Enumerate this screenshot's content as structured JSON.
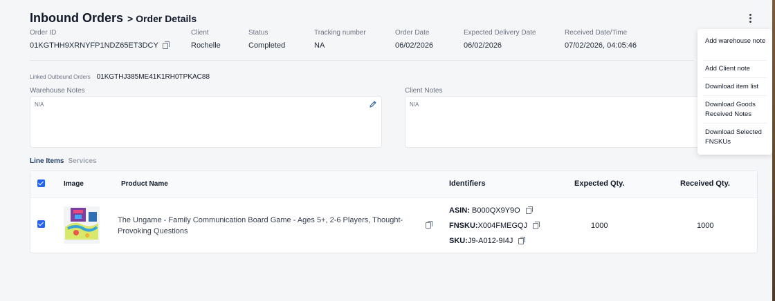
{
  "header": {
    "title": "Inbound Orders",
    "separator": ">",
    "breadcrumb": "Order Details"
  },
  "order": {
    "order_id_label": "Order ID",
    "order_id": "01KGTHH9XRNYFP1NDZ65ET3DCY",
    "client_label": "Client",
    "client": "Rochelle",
    "status_label": "Status",
    "status": "Completed",
    "tracking_label": "Tracking number",
    "tracking": "NA",
    "order_date_label": "Order Date",
    "order_date": "06/02/2026",
    "expected_label": "Expected Delivery Date",
    "expected": "06/02/2026",
    "received_label": "Received Date/Time",
    "received": "07/02/2026, 04:05:46"
  },
  "linked": {
    "label": "Linked Outbound Orders",
    "value": "01KGTHJ385ME41K1RH0TPKAC88"
  },
  "notes": {
    "warehouse_label": "Warehouse Notes",
    "warehouse_value": "N/A",
    "client_label": "Client Notes",
    "client_value": "N/A"
  },
  "tabs": [
    "Line Items",
    "Services"
  ],
  "table": {
    "headers": {
      "image": "Image",
      "product": "Product Name",
      "identifiers": "Identifiers",
      "expected": "Expected Qty.",
      "received": "Received Qty."
    },
    "row": {
      "product_name": "The Ungame - Family Communication Board Game - Ages 5+, 2-6 Players, Thought-Provoking Questions",
      "asin_label": "ASIN:",
      "asin": "B000QX9Y9O",
      "fnsku_label": "FNSKU:",
      "fnsku": "X004FMEGQJ",
      "sku_label": "SKU:",
      "sku": "J9-A012-9I4J",
      "expected_qty": "1000",
      "received_qty": "1000"
    }
  },
  "menu": {
    "items": [
      "Add warehouse note",
      "Add Client note",
      "Download item list",
      "Download Goods Received Notes",
      "Download Selected FNSKUs"
    ]
  },
  "colors": {
    "accent": "#2563eb",
    "tab_active": "#1e3a5f",
    "tab_inactive": "#9ca3af"
  },
  "icons": [
    "copy-icon",
    "pencil-icon",
    "kebab-menu-icon",
    "checkbox-icon"
  ]
}
